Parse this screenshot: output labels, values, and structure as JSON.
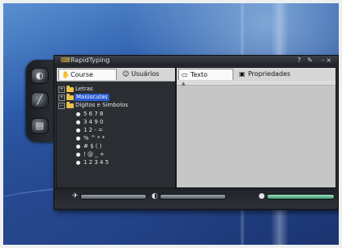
{
  "window": {
    "title": "RapidTyping",
    "help_label": "?",
    "window_controls": "- ×"
  },
  "left_tabs": [
    {
      "label": "Course",
      "icon": "course-icon"
    },
    {
      "label": "Usuários",
      "icon": "users-icon"
    }
  ],
  "right_tabs": [
    {
      "label": "Texto",
      "icon": "text-icon"
    },
    {
      "label": "Propriedades",
      "icon": "properties-icon"
    }
  ],
  "tree": {
    "folders": [
      {
        "label": "Letras",
        "expander": "+"
      },
      {
        "label": "Maiúsculas",
        "expander": "+",
        "selected": true
      },
      {
        "label": "Dígitos e Símbolos",
        "expander": "−"
      }
    ],
    "lessons": [
      "5 6 7 8",
      "3 4 9 0",
      "1 2 - =",
      "% ^ * *",
      "# $ ( )",
      "! @ _ +",
      "1 2 3 4 5"
    ]
  },
  "icons": {
    "dock": [
      "lesson-icon",
      "statistics-icon",
      "pages-icon"
    ],
    "status": [
      "runner-icon",
      "half-circle-icon",
      "circle-icon"
    ]
  },
  "status_progress": [
    0.0,
    0.0,
    1.0
  ],
  "colors": {
    "selection": "#2a5bd0",
    "progress": "#3e9a72",
    "folder": "#e8c24a"
  }
}
